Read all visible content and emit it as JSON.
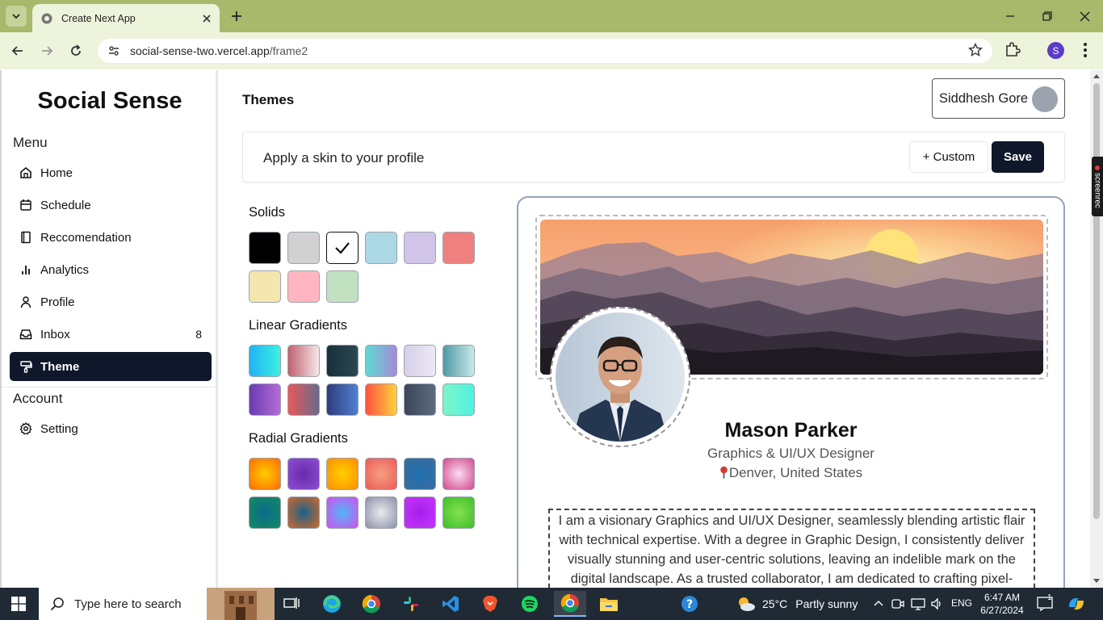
{
  "browser": {
    "tab_title": "Create Next App",
    "url_host": "social-sense-two.vercel.app",
    "url_path": "/frame2",
    "profile_initial": "S"
  },
  "sidebar": {
    "brand": "Social Sense",
    "menu_label": "Menu",
    "items": [
      {
        "label": "Home",
        "icon": "home-icon"
      },
      {
        "label": "Schedule",
        "icon": "calendar-icon"
      },
      {
        "label": "Reccomendation",
        "icon": "book-icon"
      },
      {
        "label": "Analytics",
        "icon": "bar-chart-icon"
      },
      {
        "label": "Profile",
        "icon": "user-icon"
      },
      {
        "label": "Inbox",
        "icon": "inbox-icon",
        "count": "8"
      },
      {
        "label": "Theme",
        "icon": "brush-icon",
        "active": true
      }
    ],
    "account_label": "Account",
    "account_items": [
      {
        "label": "Setting",
        "icon": "gear-icon"
      }
    ]
  },
  "main": {
    "title": "Themes",
    "user_name": "Siddhesh Gore",
    "skin_prompt": "Apply a skin to your profile",
    "custom_label": "+ Custom",
    "save_label": "Save",
    "solids_title": "Solids",
    "linear_title": "Linear Gradients",
    "radial_title": "Radial Gradients",
    "solids": [
      "#000000",
      "#d1d1d1",
      "#ffffff",
      "#add8e6",
      "#d0c4e8",
      "#f08080",
      "#f3e6ae",
      "#ffb6c1",
      "#c1e1c1"
    ],
    "solids_selected_index": 2,
    "linear": [
      [
        "#20b3f5",
        "#3df0e0"
      ],
      [
        "#c0606f",
        "#f5e8ea"
      ],
      [
        "#17313a",
        "#2c4750"
      ],
      [
        "#5ed9d1",
        "#a58bd9"
      ],
      [
        "#d7cfe7",
        "#ece9f4"
      ],
      [
        "#4e9aa3",
        "#c9e8ea"
      ],
      [
        "#6a3cb0",
        "#b46bd8"
      ],
      [
        "#e55a5a",
        "#6a6a8a"
      ],
      [
        "#2f3c7e",
        "#4f80d0"
      ],
      [
        "#ff5240",
        "#ffd23a"
      ],
      [
        "#3b4759",
        "#5c6b7f"
      ],
      [
        "#7cf5c6",
        "#4ff2e3"
      ]
    ],
    "radial": [
      [
        "#ffcc00",
        "#ff6a00"
      ],
      [
        "#6a2aa8",
        "#8c4fd6"
      ],
      [
        "#ffd000",
        "#ff8c00"
      ],
      [
        "#f5a080",
        "#ec5a5a"
      ],
      [
        "#1e6fb0",
        "#3b6e9e"
      ],
      [
        "#fadcef",
        "#d1478f"
      ],
      [
        "#0b6b8b",
        "#138a62"
      ],
      [
        "#1d5f8a",
        "#d06a2a"
      ],
      [
        "#4fb6f5",
        "#d34ff0"
      ],
      [
        "#e8eaf0",
        "#8b90a5"
      ],
      [
        "#a61ff0",
        "#c535f7"
      ],
      [
        "#86e050",
        "#3bbf2a"
      ]
    ]
  },
  "preview": {
    "name": "Mason Parker",
    "role": "Graphics & UI/UX Designer",
    "location": "Denver, United States",
    "bio": "I am a visionary Graphics and UI/UX Designer, seamlessly blending artistic flair with technical expertise. With a degree in Graphic Design, I consistently deliver visually stunning and user-centric solutions, leaving an indelible mark on the digital landscape. As a trusted collaborator, I am dedicated to crafting pixel-perfect experiences."
  },
  "extension_badge": "screenrec",
  "taskbar": {
    "search_placeholder": "Type here to search",
    "temperature": "25°C",
    "weather": "Partly sunny",
    "language": "ENG",
    "time": "6:47 AM",
    "date": "6/27/2024",
    "notifications": "1"
  },
  "colors": {
    "chrome_frame": "#a9b86a",
    "chrome_toolbar": "#eef3dc",
    "primary": "#0f172a",
    "taskbar": "#1f2a35"
  }
}
